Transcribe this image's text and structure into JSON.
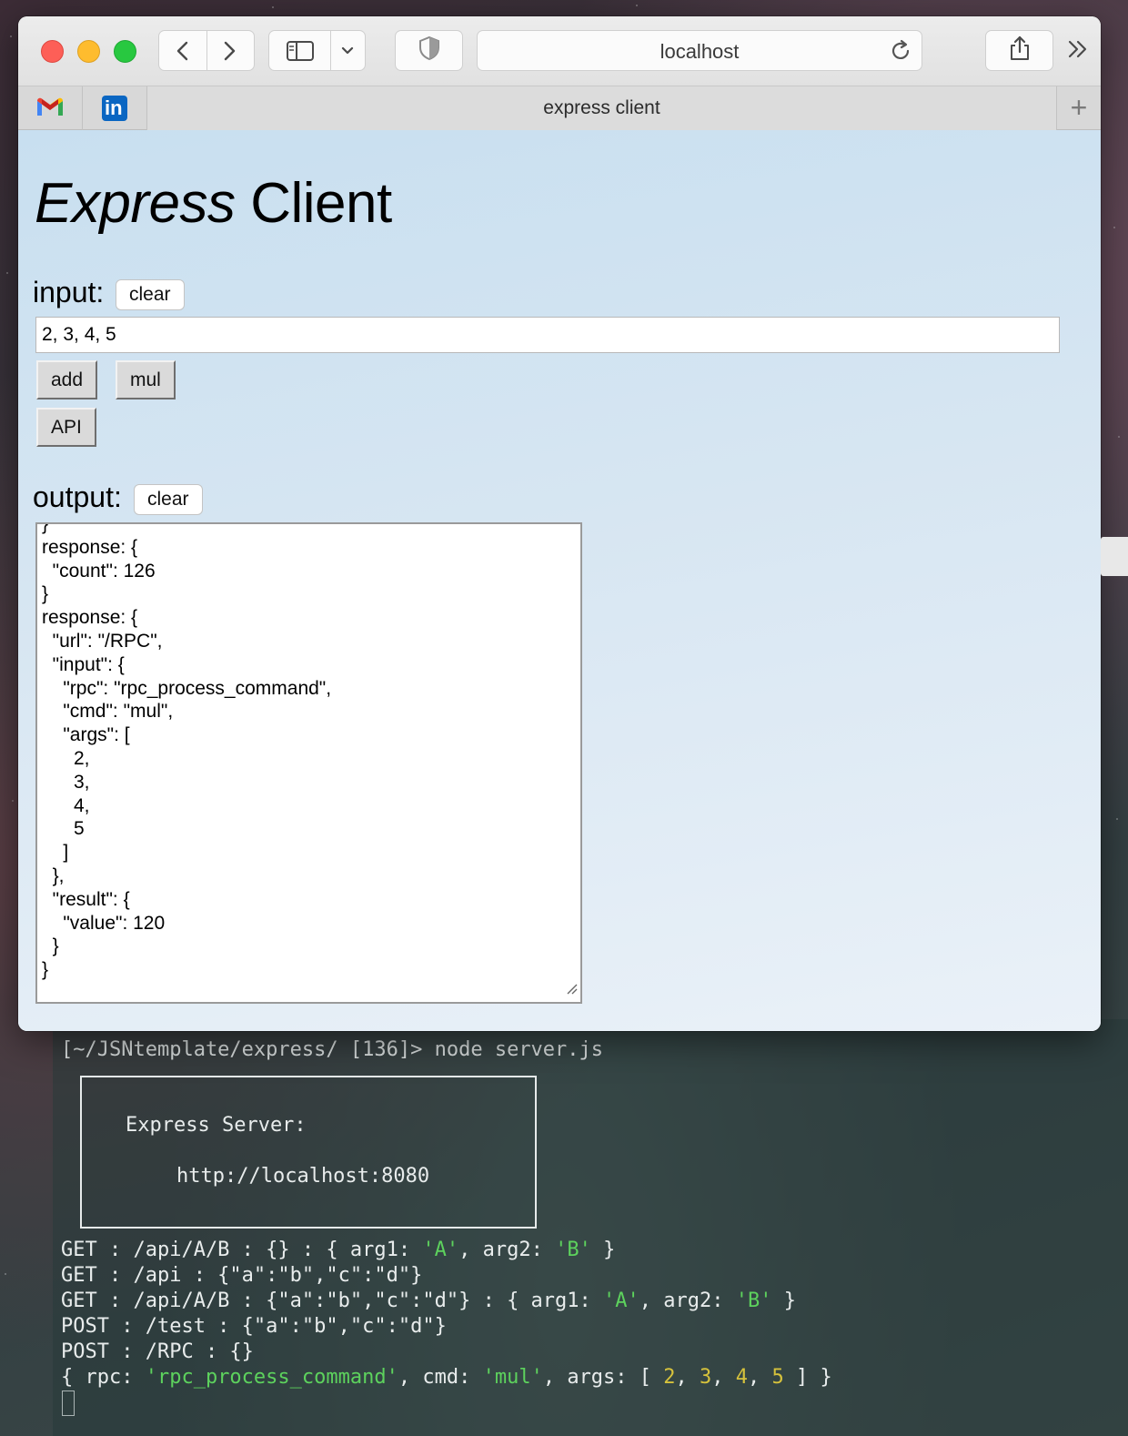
{
  "browser": {
    "url": "localhost",
    "tab_title": "express client",
    "favorites": [
      {
        "icon": "gmail-icon"
      },
      {
        "icon": "linkedin-icon",
        "text": "in"
      }
    ]
  },
  "page": {
    "title_italic": "Express",
    "title_rest": " Client",
    "input_label": "input:",
    "input_clear": "clear",
    "input_value": "2, 3, 4, 5",
    "add_label": "add",
    "mul_label": "mul",
    "api_label": "API",
    "output_label": "output:",
    "output_clear": "clear",
    "output_text": "}\nresponse: {\n  \"count\": 126\n}\nresponse: {\n  \"url\": \"/RPC\",\n  \"input\": {\n    \"rpc\": \"rpc_process_command\",\n    \"cmd\": \"mul\",\n    \"args\": [\n      2,\n      3,\n      4,\n      5\n    ]\n  },\n  \"result\": {\n    \"value\": 120\n  }\n}"
  },
  "terminal": {
    "prompt": "[~/JSNtemplate/express/ [136]> node server.js",
    "box_title": "Express Server:",
    "box_url": "http://localhost:8080",
    "lines": [
      {
        "segments": [
          {
            "t": "GET : /api/A/B : {} : { arg1: "
          },
          {
            "t": "'A'",
            "c": "str"
          },
          {
            "t": ", arg2: "
          },
          {
            "t": "'B'",
            "c": "str"
          },
          {
            "t": " }"
          }
        ]
      },
      {
        "segments": [
          {
            "t": "GET : /api : {\"a\":\"b\",\"c\":\"d\"}"
          }
        ]
      },
      {
        "segments": [
          {
            "t": "GET : /api/A/B : {\"a\":\"b\",\"c\":\"d\"} : { arg1: "
          },
          {
            "t": "'A'",
            "c": "str"
          },
          {
            "t": ", arg2: "
          },
          {
            "t": "'B'",
            "c": "str"
          },
          {
            "t": " }"
          }
        ]
      },
      {
        "segments": [
          {
            "t": "POST : /test : {\"a\":\"b\",\"c\":\"d\"}"
          }
        ]
      },
      {
        "segments": [
          {
            "t": "POST : /RPC : {}"
          }
        ]
      },
      {
        "segments": [
          {
            "t": "{ rpc: "
          },
          {
            "t": "'rpc_process_command'",
            "c": "str"
          },
          {
            "t": ", cmd: "
          },
          {
            "t": "'mul'",
            "c": "str"
          },
          {
            "t": ", args: [ "
          },
          {
            "t": "2",
            "c": "num"
          },
          {
            "t": ", "
          },
          {
            "t": "3",
            "c": "num"
          },
          {
            "t": ", "
          },
          {
            "t": "4",
            "c": "num"
          },
          {
            "t": ", "
          },
          {
            "t": "5",
            "c": "num"
          },
          {
            "t": " ] }"
          }
        ]
      }
    ]
  },
  "colors": {
    "string": "#5dd25d",
    "number": "#d6c23c"
  }
}
